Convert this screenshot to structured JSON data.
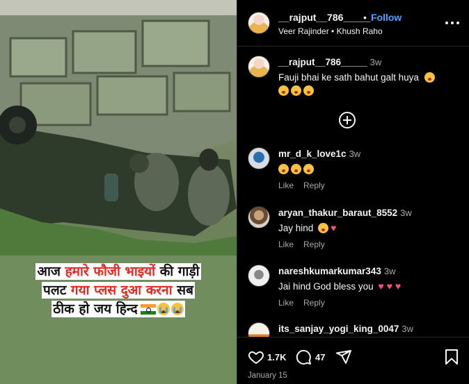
{
  "media": {
    "caption": {
      "line1": [
        {
          "text": "आज ",
          "color": "black"
        },
        {
          "text": "हमारे फौजी भाइयों",
          "color": "red"
        },
        {
          "text": " की गाड़ी",
          "color": "black"
        }
      ],
      "line2": [
        {
          "text": "पलट ",
          "color": "black"
        },
        {
          "text": "गया प्लस दुआ करना",
          "color": "red"
        },
        {
          "text": " सब",
          "color": "black"
        }
      ],
      "line3": [
        {
          "text": "ठीक हो जय हिन्द",
          "color": "black"
        }
      ],
      "line3_emojis": [
        "india-flag-icon",
        "crying-face-icon",
        "crying-face-icon"
      ]
    }
  },
  "post": {
    "username": "__rajput__786_____",
    "separator": "•",
    "follow_label": "Follow",
    "audio": "Veer Rajinder • Khush Raho"
  },
  "comments": [
    {
      "username": "__rajput__786_____",
      "time": "3w",
      "text": "Fauji bhai ke sath bahut galt huya",
      "emojis": 4,
      "show_actions": false
    },
    {
      "username": "mr_d_k_love1c",
      "time": "3w",
      "text": "",
      "emojis": 3,
      "show_actions": true
    },
    {
      "username": "aryan_thakur_baraut_8552",
      "time": "3w",
      "text": "Jay hind",
      "emojis": 1,
      "hearts": 1,
      "show_actions": true
    },
    {
      "username": "nareshkumarkumar343",
      "time": "3w",
      "text": "Jai hind God bless you",
      "emojis": 0,
      "hearts": 3,
      "show_actions": true
    },
    {
      "username": "its_sanjay_yogi_king_0047",
      "time": "3w",
      "text": "",
      "emojis": 0,
      "show_actions": false
    }
  ],
  "actions": {
    "like": "Like",
    "reply": "Reply"
  },
  "footer": {
    "likes": "1.7K",
    "comments": "47",
    "date": "January 15"
  },
  "colors": {
    "accent": "#4aa3ff",
    "caption_red": "#e8261c",
    "heart": "#ff4d7d"
  }
}
